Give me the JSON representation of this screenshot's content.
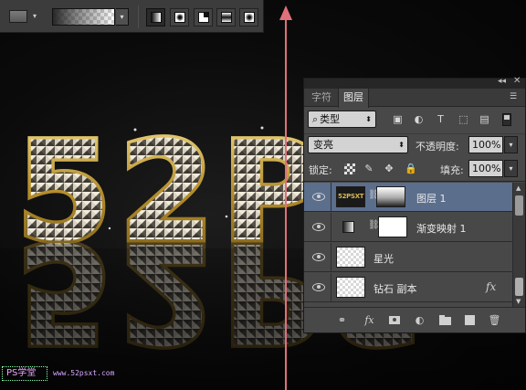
{
  "artwork": {
    "text": "52PS"
  },
  "options_bar": {
    "swatch_arrow": "▾",
    "gradient_arrow": "▾",
    "gradient_types": [
      "linear",
      "radial",
      "angle",
      "reflected",
      "diamond"
    ],
    "active_gradient_type": "linear"
  },
  "panel": {
    "collapse_icon": "◂◂",
    "close_icon": "✕",
    "tabs": [
      {
        "label": "字符",
        "active": false
      },
      {
        "label": "图层",
        "active": true
      }
    ],
    "menu_icon": "☰",
    "filter": {
      "icon": "⌕",
      "label": "类型",
      "arrow": "⬍",
      "filter_icons": [
        "image-filter-icon",
        "adjustment-filter-icon",
        "type-filter-icon",
        "shape-filter-icon",
        "smart-object-filter-icon"
      ],
      "type_icon_glyph": "T"
    },
    "blend_mode": "变亮",
    "blend_arrow": "⬍",
    "opacity_label": "不透明度:",
    "opacity_value": "100%",
    "lock_label": "锁定:",
    "fill_label": "填充:",
    "fill_value": "100%",
    "dropdown_arrow": "▾",
    "layers": [
      {
        "name": "图层 1",
        "thumb_text": "52PSXT",
        "selected": true,
        "has_mask": true
      },
      {
        "name": "渐变映射 1",
        "type": "adjustment",
        "selected": false,
        "has_mask": true
      },
      {
        "name": "星光",
        "selected": false,
        "has_mask": false
      },
      {
        "name": "钻石 副本",
        "selected": false,
        "has_mask": false,
        "fx": "fx"
      }
    ],
    "bottom_icons": {
      "link": "⚭",
      "fx": "fx",
      "adjust": "◐",
      "trash": "🗑"
    }
  },
  "watermark": {
    "logo": "PS学堂",
    "url": "www.52psxt.com"
  },
  "colors": {
    "gold": "#c9a53a",
    "gold_dark": "#6b5317",
    "guide_arrow": "#e0707a",
    "panel_bg": "#484848",
    "selected_row": "#5b6e8c"
  }
}
